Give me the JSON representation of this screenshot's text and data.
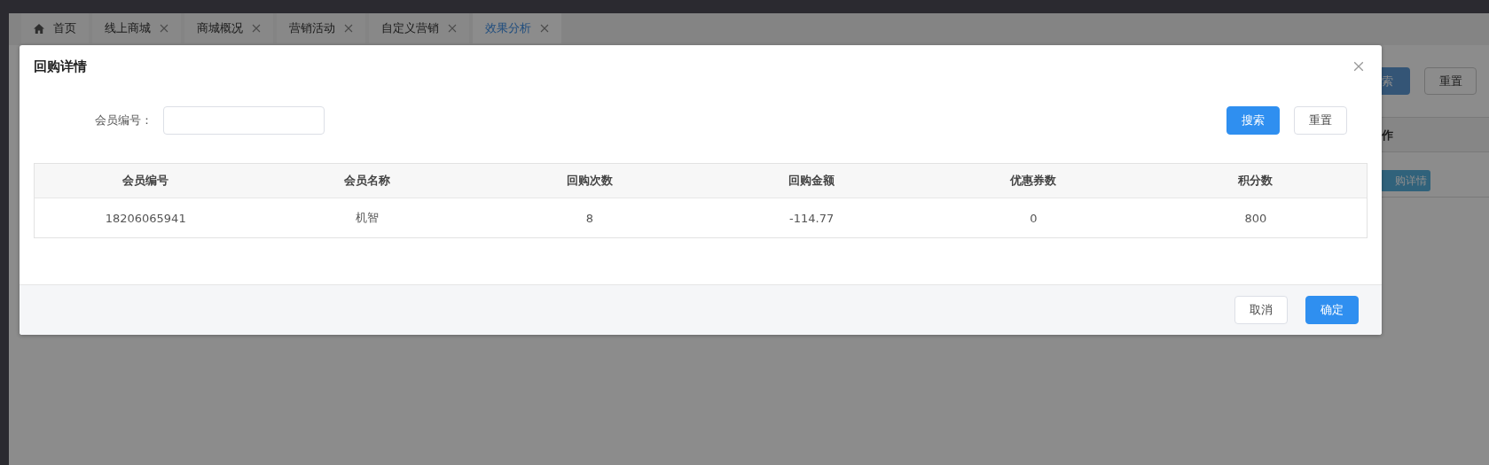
{
  "background_page": {
    "tabs": [
      {
        "label": "首页",
        "kind": "home",
        "selected": false
      },
      {
        "label": "线上商城",
        "kind": "page",
        "selected": false
      },
      {
        "label": "商城概况",
        "kind": "page",
        "selected": false
      },
      {
        "label": "营销活动",
        "kind": "page",
        "selected": false
      },
      {
        "label": "自定义营销",
        "kind": "page",
        "selected": false
      },
      {
        "label": "效果分析",
        "kind": "page",
        "selected": true
      }
    ],
    "toolbar": {
      "search_button": "索",
      "reset_button": "重置"
    },
    "table": {
      "column_header": "作",
      "row_button": "购详情"
    }
  },
  "dialog": {
    "title": "回购详情",
    "filter": {
      "label": "会员编号：",
      "search_button": "搜索",
      "reset_button": "重置"
    },
    "table": {
      "columns": [
        "会员编号",
        "会员名称",
        "回购次数",
        "回购金额",
        "优惠券数",
        "积分数"
      ],
      "rows": [
        [
          "18206065941",
          "机智",
          "8",
          "-114.77",
          "0",
          "800"
        ]
      ]
    },
    "footer": {
      "cancel_button": "取消",
      "confirm_button": "确定"
    }
  }
}
